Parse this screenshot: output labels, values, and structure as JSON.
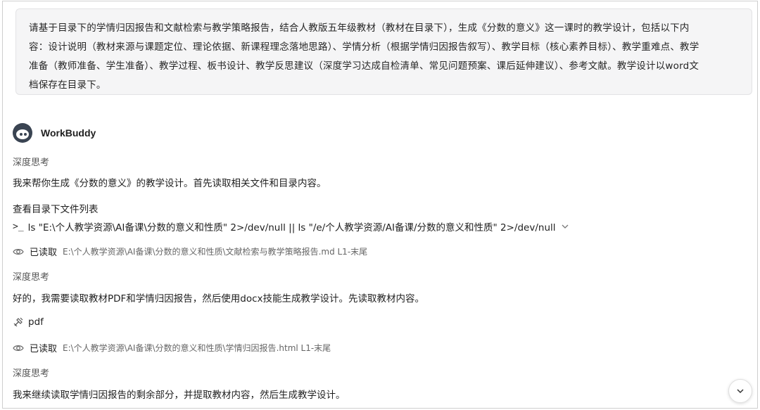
{
  "user_prompt": {
    "line1": "请基于目录下的学情归因报告和文献检索与教学策略报告，结合人教版五年级教材（教材在目录下），生成《分数的意义》这一课时的教学设计，包括以下内",
    "line2": "容：设计说明（教材来源与课题定位、理论依据、新课程理念落地思路）、学情分析（根据学情归因报告叙写）、教学目标（核心素养目标）、教学重难点、教学",
    "line3": "准备（教师准备、学生准备）、教学过程、板书设计、教学反思建议（深度学习达成自检清单、常见问题预案、课后延伸建议）、参考文献。教学设计以word文",
    "line4": "档保存在目录下。"
  },
  "assistant": {
    "name": "WorkBuddy",
    "avatar_icon": "robot-avatar-icon"
  },
  "steps": {
    "thinking_1": "深度思考",
    "reply_1": "我来帮你生成《分数的意义》的教学设计。首先读取相关文件和目录内容。",
    "command_title": "查看目录下文件列表",
    "command_prompt": ">_",
    "command_text": "ls \"E:\\个人教学资源\\AI备课\\分数的意义和性质\" 2>/dev/null || ls \"/e/个人教学资源/AI备课/分数的意义和性质\" 2>/dev/null",
    "read_1_label": "已读取",
    "read_1_path": "E:\\个人教学资源\\AI备课\\分数的意义和性质\\文献检索与教学策略报告.md  L1-末尾",
    "thinking_2": "深度思考",
    "reply_2": "好的，我需要读取教材PDF和学情归因报告，然后使用docx技能生成教学设计。先读取教材内容。",
    "tool_label": "pdf",
    "read_2_label": "已读取",
    "read_2_path": "E:\\个人教学资源\\AI备课\\分数的意义和性质\\学情归因报告.html  L1-末尾",
    "thinking_3": "深度思考",
    "reply_3": "我来继续读取学情归因报告的剩余部分，并提取教材内容，然后生成教学设计。"
  },
  "icons": {
    "chevron": "chevron-down-icon",
    "eye": "eye-icon",
    "tool": "tool-icon",
    "scroll": "scroll-down-icon"
  }
}
